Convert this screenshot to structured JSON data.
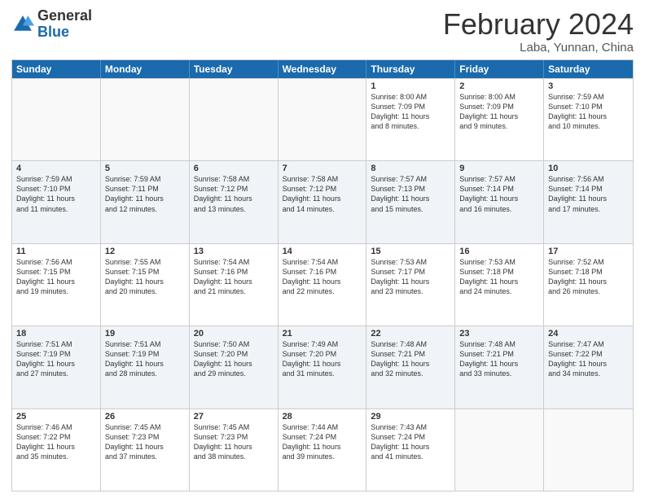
{
  "header": {
    "logo_general": "General",
    "logo_blue": "Blue",
    "month_title": "February 2024",
    "location": "Laba, Yunnan, China"
  },
  "weekdays": [
    "Sunday",
    "Monday",
    "Tuesday",
    "Wednesday",
    "Thursday",
    "Friday",
    "Saturday"
  ],
  "rows": [
    [
      {
        "day": "",
        "lines": []
      },
      {
        "day": "",
        "lines": []
      },
      {
        "day": "",
        "lines": []
      },
      {
        "day": "",
        "lines": []
      },
      {
        "day": "1",
        "lines": [
          "Sunrise: 8:00 AM",
          "Sunset: 7:09 PM",
          "Daylight: 11 hours",
          "and 8 minutes."
        ]
      },
      {
        "day": "2",
        "lines": [
          "Sunrise: 8:00 AM",
          "Sunset: 7:09 PM",
          "Daylight: 11 hours",
          "and 9 minutes."
        ]
      },
      {
        "day": "3",
        "lines": [
          "Sunrise: 7:59 AM",
          "Sunset: 7:10 PM",
          "Daylight: 11 hours",
          "and 10 minutes."
        ]
      }
    ],
    [
      {
        "day": "4",
        "lines": [
          "Sunrise: 7:59 AM",
          "Sunset: 7:10 PM",
          "Daylight: 11 hours",
          "and 11 minutes."
        ]
      },
      {
        "day": "5",
        "lines": [
          "Sunrise: 7:59 AM",
          "Sunset: 7:11 PM",
          "Daylight: 11 hours",
          "and 12 minutes."
        ]
      },
      {
        "day": "6",
        "lines": [
          "Sunrise: 7:58 AM",
          "Sunset: 7:12 PM",
          "Daylight: 11 hours",
          "and 13 minutes."
        ]
      },
      {
        "day": "7",
        "lines": [
          "Sunrise: 7:58 AM",
          "Sunset: 7:12 PM",
          "Daylight: 11 hours",
          "and 14 minutes."
        ]
      },
      {
        "day": "8",
        "lines": [
          "Sunrise: 7:57 AM",
          "Sunset: 7:13 PM",
          "Daylight: 11 hours",
          "and 15 minutes."
        ]
      },
      {
        "day": "9",
        "lines": [
          "Sunrise: 7:57 AM",
          "Sunset: 7:14 PM",
          "Daylight: 11 hours",
          "and 16 minutes."
        ]
      },
      {
        "day": "10",
        "lines": [
          "Sunrise: 7:56 AM",
          "Sunset: 7:14 PM",
          "Daylight: 11 hours",
          "and 17 minutes."
        ]
      }
    ],
    [
      {
        "day": "11",
        "lines": [
          "Sunrise: 7:56 AM",
          "Sunset: 7:15 PM",
          "Daylight: 11 hours",
          "and 19 minutes."
        ]
      },
      {
        "day": "12",
        "lines": [
          "Sunrise: 7:55 AM",
          "Sunset: 7:15 PM",
          "Daylight: 11 hours",
          "and 20 minutes."
        ]
      },
      {
        "day": "13",
        "lines": [
          "Sunrise: 7:54 AM",
          "Sunset: 7:16 PM",
          "Daylight: 11 hours",
          "and 21 minutes."
        ]
      },
      {
        "day": "14",
        "lines": [
          "Sunrise: 7:54 AM",
          "Sunset: 7:16 PM",
          "Daylight: 11 hours",
          "and 22 minutes."
        ]
      },
      {
        "day": "15",
        "lines": [
          "Sunrise: 7:53 AM",
          "Sunset: 7:17 PM",
          "Daylight: 11 hours",
          "and 23 minutes."
        ]
      },
      {
        "day": "16",
        "lines": [
          "Sunrise: 7:53 AM",
          "Sunset: 7:18 PM",
          "Daylight: 11 hours",
          "and 24 minutes."
        ]
      },
      {
        "day": "17",
        "lines": [
          "Sunrise: 7:52 AM",
          "Sunset: 7:18 PM",
          "Daylight: 11 hours",
          "and 26 minutes."
        ]
      }
    ],
    [
      {
        "day": "18",
        "lines": [
          "Sunrise: 7:51 AM",
          "Sunset: 7:19 PM",
          "Daylight: 11 hours",
          "and 27 minutes."
        ]
      },
      {
        "day": "19",
        "lines": [
          "Sunrise: 7:51 AM",
          "Sunset: 7:19 PM",
          "Daylight: 11 hours",
          "and 28 minutes."
        ]
      },
      {
        "day": "20",
        "lines": [
          "Sunrise: 7:50 AM",
          "Sunset: 7:20 PM",
          "Daylight: 11 hours",
          "and 29 minutes."
        ]
      },
      {
        "day": "21",
        "lines": [
          "Sunrise: 7:49 AM",
          "Sunset: 7:20 PM",
          "Daylight: 11 hours",
          "and 31 minutes."
        ]
      },
      {
        "day": "22",
        "lines": [
          "Sunrise: 7:48 AM",
          "Sunset: 7:21 PM",
          "Daylight: 11 hours",
          "and 32 minutes."
        ]
      },
      {
        "day": "23",
        "lines": [
          "Sunrise: 7:48 AM",
          "Sunset: 7:21 PM",
          "Daylight: 11 hours",
          "and 33 minutes."
        ]
      },
      {
        "day": "24",
        "lines": [
          "Sunrise: 7:47 AM",
          "Sunset: 7:22 PM",
          "Daylight: 11 hours",
          "and 34 minutes."
        ]
      }
    ],
    [
      {
        "day": "25",
        "lines": [
          "Sunrise: 7:46 AM",
          "Sunset: 7:22 PM",
          "Daylight: 11 hours",
          "and 35 minutes."
        ]
      },
      {
        "day": "26",
        "lines": [
          "Sunrise: 7:45 AM",
          "Sunset: 7:23 PM",
          "Daylight: 11 hours",
          "and 37 minutes."
        ]
      },
      {
        "day": "27",
        "lines": [
          "Sunrise: 7:45 AM",
          "Sunset: 7:23 PM",
          "Daylight: 11 hours",
          "and 38 minutes."
        ]
      },
      {
        "day": "28",
        "lines": [
          "Sunrise: 7:44 AM",
          "Sunset: 7:24 PM",
          "Daylight: 11 hours",
          "and 39 minutes."
        ]
      },
      {
        "day": "29",
        "lines": [
          "Sunrise: 7:43 AM",
          "Sunset: 7:24 PM",
          "Daylight: 11 hours",
          "and 41 minutes."
        ]
      },
      {
        "day": "",
        "lines": []
      },
      {
        "day": "",
        "lines": []
      }
    ]
  ],
  "colors": {
    "header_bg": "#1a6aad",
    "row_alt": "#e8f0f8",
    "border": "#ccc"
  }
}
